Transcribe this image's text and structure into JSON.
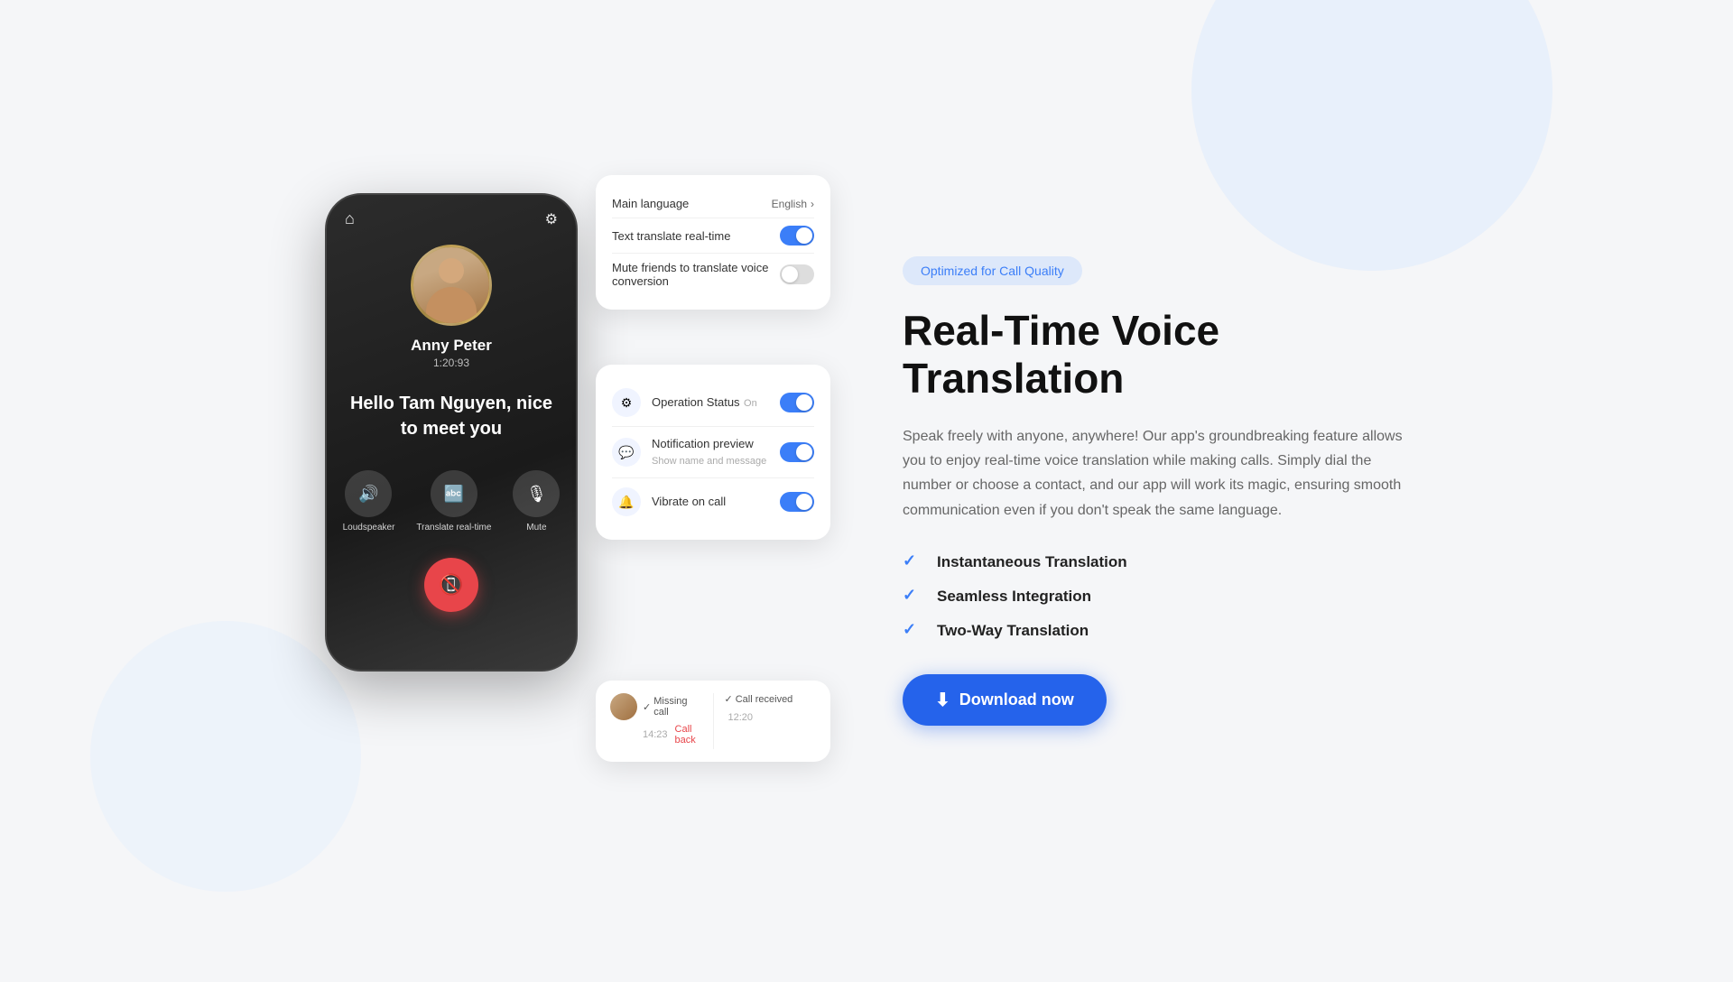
{
  "badge": {
    "label": "Optimized for Call Quality"
  },
  "hero": {
    "title": "Real-Time Voice Translation",
    "description": "Speak freely with anyone, anywhere! Our app's groundbreaking feature allows you to enjoy real-time voice translation while making calls. Simply dial the number or choose a contact, and our app will work its magic, ensuring smooth communication even if you don't speak the same language."
  },
  "features": [
    {
      "label": "Instantaneous Translation"
    },
    {
      "label": "Seamless Integration"
    },
    {
      "label": "Two-Way Translation"
    }
  ],
  "download_button": {
    "label": "Download now"
  },
  "phone": {
    "caller_name": "Anny Peter",
    "call_duration": "1:20:93",
    "message": "Hello Tam Nguyen, nice to meet you",
    "controls": [
      {
        "label": "Loudspeaker"
      },
      {
        "label": "Translate real-time"
      },
      {
        "label": "Mute"
      }
    ]
  },
  "translation_card": {
    "rows": [
      {
        "label": "Main language",
        "value": "English",
        "toggle": null
      },
      {
        "label": "Text translate real-time",
        "value": null,
        "toggle": "on"
      },
      {
        "label": "Mute friends to translate voice conversion",
        "value": null,
        "toggle": "off"
      }
    ]
  },
  "notifications_card": {
    "items": [
      {
        "title": "Operation Status",
        "sub": "On",
        "toggle": "on",
        "icon": "⚙"
      },
      {
        "title": "Notification preview",
        "sub": "Show name and message",
        "toggle": "on",
        "icon": "💬"
      },
      {
        "title": "Vibrate on call",
        "sub": null,
        "toggle": "on",
        "icon": "🔔"
      }
    ]
  },
  "calls_card": {
    "missed": {
      "label": "Missing call",
      "time": "14:23",
      "action": "Call back"
    },
    "received": {
      "label": "Call received",
      "time": "12:20"
    }
  }
}
